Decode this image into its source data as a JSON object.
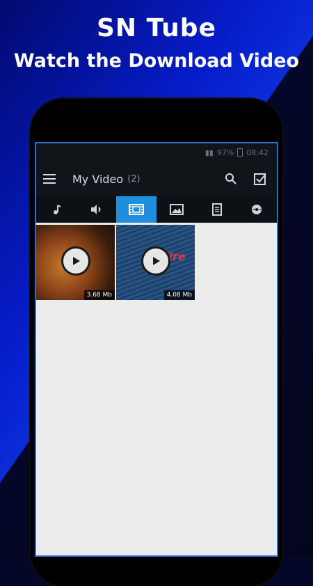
{
  "promo": {
    "title": "SN Tube",
    "subtitle": "Watch the Download Video"
  },
  "status_bar": {
    "battery": "97%",
    "time": "08:42"
  },
  "app_bar": {
    "title": "My Video",
    "count": "(2)"
  },
  "tabs": [
    {
      "icon": "music-note-icon",
      "active": false
    },
    {
      "icon": "speaker-icon",
      "active": false
    },
    {
      "icon": "video-icon",
      "active": true
    },
    {
      "icon": "image-icon",
      "active": false
    },
    {
      "icon": "document-icon",
      "active": false
    },
    {
      "icon": "disc-icon",
      "active": false
    }
  ],
  "videos": [
    {
      "size": "3.68 Mb"
    },
    {
      "size": "4.08 Mb",
      "overlay_text": "Wire"
    }
  ],
  "colors": {
    "accent": "#1f8ee0",
    "app_bar": "#111418",
    "background": "#ececec"
  }
}
